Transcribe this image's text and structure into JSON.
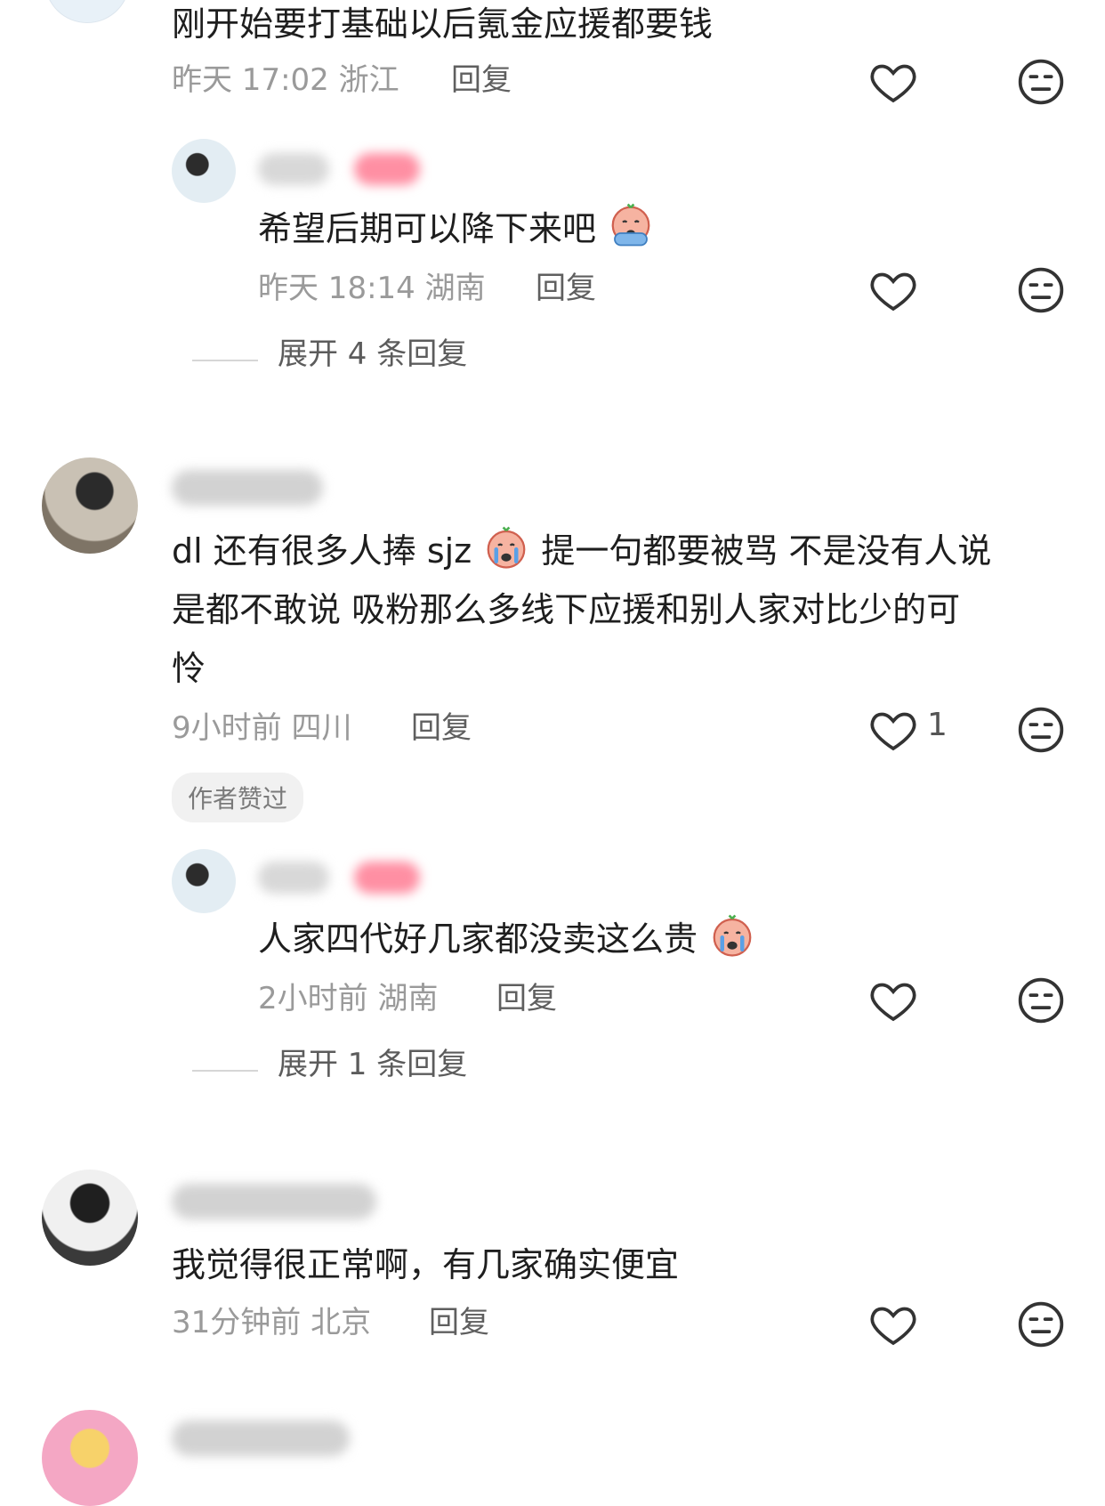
{
  "colors": {
    "meta": "#9a9a9a",
    "text": "#1e1e1e",
    "badge_bg": "#f1f1f1",
    "name_blur_red": "#ff6f8a"
  },
  "icons": {
    "like": "heart-outline-icon",
    "dislike": "neutral-face-icon",
    "emoji": "crying-emoji-icon"
  },
  "comments": {
    "c1": {
      "text": "刚开始要打基础以后氪金应援都要钱",
      "time": "昨天 17:02 浙江",
      "reply": "回复"
    },
    "r1": {
      "text": "希望后期可以降下来吧",
      "time": "昨天 18:14 湖南",
      "reply": "回复"
    },
    "expand1": "展开 4 条回复",
    "c2": {
      "line1": "dl 还有很多人捧 sjz",
      "line1b": "提一句都要被骂 不是没有人说",
      "line2": "是都不敢说 吸粉那么多线下应援和别人家对比少的可",
      "line3": "怜",
      "time": "9小时前 四川",
      "reply": "回复",
      "likes": "1",
      "badge": "作者赞过"
    },
    "r2": {
      "text": "人家四代好几家都没卖这么贵",
      "time": "2小时前 湖南",
      "reply": "回复"
    },
    "expand2": "展开 1 条回复",
    "c3": {
      "text": "我觉得很正常啊，有几家确实便宜",
      "time": "31分钟前 北京",
      "reply": "回复"
    }
  }
}
